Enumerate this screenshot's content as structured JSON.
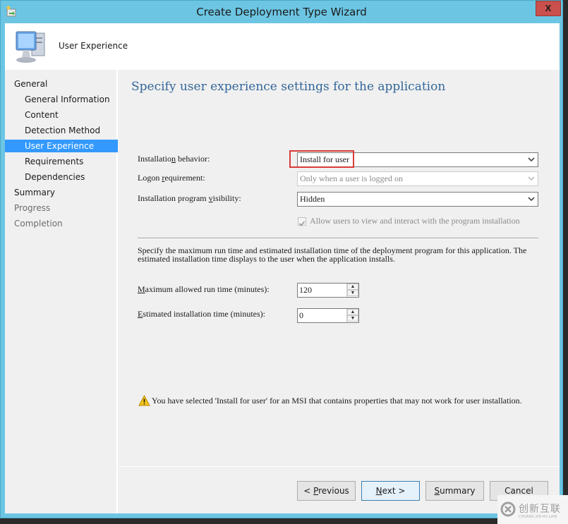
{
  "window": {
    "title": "Create Deployment Type Wizard",
    "close_label": "X",
    "icon": "wizard-app-icon"
  },
  "header": {
    "title": "User Experience",
    "icon": "computer-icon"
  },
  "sidebar": {
    "items": [
      {
        "label": "General",
        "level": 1,
        "state": "normal"
      },
      {
        "label": "General Information",
        "level": 2,
        "state": "normal"
      },
      {
        "label": "Content",
        "level": 2,
        "state": "normal"
      },
      {
        "label": "Detection Method",
        "level": 2,
        "state": "normal"
      },
      {
        "label": "User Experience",
        "level": 2,
        "state": "active"
      },
      {
        "label": "Requirements",
        "level": 2,
        "state": "normal"
      },
      {
        "label": "Dependencies",
        "level": 2,
        "state": "normal"
      },
      {
        "label": "Summary",
        "level": 1,
        "state": "normal"
      },
      {
        "label": "Progress",
        "level": 1,
        "state": "disabled"
      },
      {
        "label": "Completion",
        "level": 1,
        "state": "disabled"
      }
    ]
  },
  "main": {
    "heading": "Specify user experience settings for the application",
    "installation_behavior": {
      "label": "Installation behavior:",
      "value": "Install for user",
      "enabled": true
    },
    "logon_requirement": {
      "label": "Logon requirement:",
      "value": "Only when a user is logged on",
      "enabled": false
    },
    "program_visibility": {
      "label": "Installation program visibility:",
      "value": "Hidden",
      "enabled": true
    },
    "allow_interact": {
      "label": "Allow users to view and interact with the program installation",
      "checked": true,
      "enabled": false
    },
    "description": "Specify the maximum run time and estimated installation time of the deployment program for this application. The estimated installation time displays to the user when the application installs.",
    "max_run_time": {
      "label": "Maximum allowed run time (minutes):",
      "value": "120"
    },
    "est_install_time": {
      "label": "Estimated installation time (minutes):",
      "value": "0"
    },
    "warning": "You have selected 'Install for user' for an MSI that contains properties that may not work for user installation."
  },
  "buttons": {
    "previous": "< Previous",
    "next": "Next >",
    "summary": "Summary",
    "cancel": "Cancel"
  },
  "watermark": {
    "text": "创新互联",
    "sub": "CHUANG XIN HU LIAN"
  },
  "colors": {
    "title_bar": "#6cc6e3",
    "heading": "#336699",
    "selection": "#3399ff",
    "highlight": "#d93a3a",
    "close_button": "#c9504c"
  }
}
